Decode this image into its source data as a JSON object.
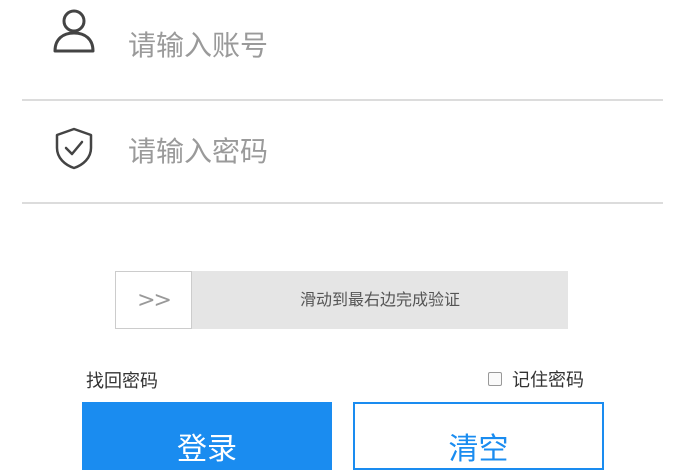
{
  "login_form": {
    "account": {
      "placeholder": "请输入账号",
      "value": "",
      "icon": "user-icon"
    },
    "password": {
      "placeholder": "请输入密码",
      "value": "",
      "icon": "shield-check-icon"
    },
    "slider_captcha": {
      "handle_glyph": ">>",
      "text": "滑动到最右边完成验证",
      "progress": 0
    },
    "forgot_password_label": "找回密码",
    "remember_password": {
      "label": "记住密码",
      "checked": false
    },
    "login_button_label": "登录",
    "clear_button_label": "清空"
  },
  "colors": {
    "primary": "#1a8cf0",
    "divider": "#dcdcdc",
    "slider_track": "#e5e5e5",
    "placeholder": "#9a9a9a"
  }
}
